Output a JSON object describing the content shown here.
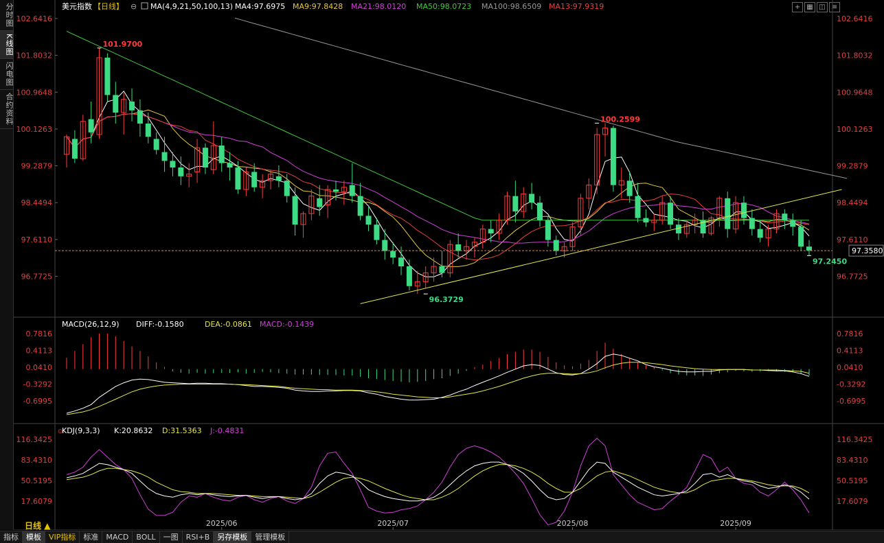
{
  "sidebar": {
    "tabs": [
      {
        "label": "分时图",
        "active": false
      },
      {
        "label": "K线图",
        "active": true
      },
      {
        "label": "闪电图",
        "active": false
      },
      {
        "label": "合约资料",
        "active": false
      }
    ]
  },
  "header": {
    "instrument": "美元指数",
    "period_tag": "【日线】",
    "ma_label": "MA(4,9,21,50,100,13)",
    "ma": [
      {
        "label": "MA4:97.6975",
        "color": "#ffffff"
      },
      {
        "label": "MA9:97.8428",
        "color": "#e6c84a"
      },
      {
        "label": "MA21:98.0120",
        "color": "#d040d8"
      },
      {
        "label": "MA50:98.0723",
        "color": "#40c840"
      },
      {
        "label": "MA100:98.6509",
        "color": "#999999"
      },
      {
        "label": "MA13:97.9319",
        "color": "#e84040"
      }
    ]
  },
  "toolbar_icons": [
    "zoom-in-icon",
    "grid-icon",
    "layout-icon",
    "list-icon"
  ],
  "bottom_bar": {
    "period": "日线",
    "buttons": [
      {
        "label": "指标",
        "selected": false,
        "vip": false
      },
      {
        "label": "模板",
        "selected": true,
        "vip": false
      },
      {
        "label": "VIP指标",
        "selected": false,
        "vip": true
      },
      {
        "label": "标准",
        "selected": false,
        "vip": false
      },
      {
        "label": "MACD",
        "selected": false,
        "vip": false
      },
      {
        "label": "BOLL",
        "selected": false,
        "vip": false
      },
      {
        "label": "一图",
        "selected": false,
        "vip": false
      },
      {
        "label": "RSI+B",
        "selected": false,
        "vip": false
      },
      {
        "label": "另存模板",
        "selected": true,
        "vip": false
      },
      {
        "label": "管理模板",
        "selected": false,
        "vip": false
      }
    ]
  },
  "chart_data": [
    {
      "type": "candlestick",
      "title": "美元指数【日线】",
      "y_ticks": [
        "102.6416",
        "101.8032",
        "100.9648",
        "100.1263",
        "99.2879",
        "98.4494",
        "97.6110",
        "96.7725"
      ],
      "ylim": [
        96.25,
        102.75
      ],
      "x_labels": [
        {
          "label": "2025/06",
          "index": 19
        },
        {
          "label": "2025/07",
          "index": 40
        },
        {
          "label": "2025/08",
          "index": 62
        },
        {
          "label": "2025/09",
          "index": 82
        }
      ],
      "current_price": "97.3580",
      "annotations": [
        {
          "label": "101.9700",
          "index": 4,
          "value": 101.97,
          "color": "#ff3b3b",
          "pos": "above"
        },
        {
          "label": "96.3729",
          "index": 44,
          "value": 96.3729,
          "color": "#3ddc84",
          "pos": "below"
        },
        {
          "label": "100.2599",
          "index": 65,
          "value": 100.2599,
          "color": "#ff3b3b",
          "pos": "above"
        },
        {
          "label": "97.2450",
          "index": 91,
          "value": 97.245,
          "color": "#3ddc84",
          "pos": "below"
        }
      ],
      "trendline": {
        "from": [
          36,
          96.15
        ],
        "to": [
          95,
          98.75
        ],
        "color": "#e6e64a"
      },
      "ohlc": [
        [
          99.55,
          100.0,
          99.25,
          99.95
        ],
        [
          99.9,
          100.1,
          99.35,
          99.45
        ],
        [
          99.45,
          100.45,
          99.4,
          100.3
        ],
        [
          100.35,
          100.75,
          99.8,
          100.05
        ],
        [
          100.0,
          101.97,
          99.9,
          101.75
        ],
        [
          101.75,
          101.85,
          100.75,
          100.9
        ],
        [
          100.9,
          101.2,
          100.25,
          100.5
        ],
        [
          100.5,
          100.95,
          100.0,
          100.8
        ],
        [
          100.75,
          101.05,
          100.3,
          100.55
        ],
        [
          100.55,
          100.8,
          99.95,
          100.25
        ],
        [
          100.25,
          100.5,
          99.8,
          99.95
        ],
        [
          99.9,
          100.05,
          99.55,
          99.65
        ],
        [
          99.6,
          99.95,
          99.15,
          99.4
        ],
        [
          99.4,
          99.6,
          99.05,
          99.25
        ],
        [
          99.25,
          99.5,
          98.85,
          99.05
        ],
        [
          99.05,
          99.35,
          98.8,
          99.1
        ],
        [
          99.15,
          99.9,
          98.9,
          99.7
        ],
        [
          99.7,
          99.8,
          99.1,
          99.25
        ],
        [
          99.2,
          100.3,
          99.1,
          99.75
        ],
        [
          99.75,
          99.95,
          99.15,
          99.35
        ],
        [
          99.35,
          99.6,
          98.95,
          99.25
        ],
        [
          99.25,
          99.4,
          98.65,
          98.75
        ],
        [
          98.75,
          99.25,
          98.6,
          99.15
        ],
        [
          99.15,
          99.35,
          98.7,
          98.8
        ],
        [
          98.8,
          99.1,
          98.55,
          98.95
        ],
        [
          98.95,
          99.2,
          98.75,
          99.1
        ],
        [
          99.05,
          99.3,
          98.8,
          98.95
        ],
        [
          98.95,
          99.1,
          98.45,
          98.6
        ],
        [
          98.6,
          98.8,
          97.7,
          97.95
        ],
        [
          97.95,
          98.25,
          97.65,
          98.2
        ],
        [
          98.2,
          98.75,
          98.05,
          98.6
        ],
        [
          98.55,
          98.85,
          98.15,
          98.35
        ],
        [
          98.4,
          98.85,
          98.1,
          98.75
        ],
        [
          98.75,
          98.95,
          98.5,
          98.7
        ],
        [
          98.7,
          98.95,
          98.4,
          98.8
        ],
        [
          98.85,
          99.35,
          98.45,
          98.6
        ],
        [
          98.6,
          98.9,
          98.05,
          98.15
        ],
        [
          98.15,
          98.35,
          97.8,
          97.95
        ],
        [
          97.95,
          98.1,
          97.5,
          97.6
        ],
        [
          97.6,
          97.85,
          97.15,
          97.35
        ],
        [
          97.35,
          97.55,
          97.05,
          97.2
        ],
        [
          97.2,
          97.45,
          96.8,
          97.0
        ],
        [
          97.0,
          97.15,
          96.45,
          96.55
        ],
        [
          96.55,
          96.9,
          96.37,
          96.65
        ],
        [
          96.65,
          97.0,
          96.5,
          96.85
        ],
        [
          96.85,
          97.2,
          96.65,
          97.0
        ],
        [
          97.0,
          97.35,
          96.75,
          96.85
        ],
        [
          96.85,
          97.6,
          96.75,
          97.5
        ],
        [
          97.5,
          97.75,
          97.2,
          97.35
        ],
        [
          97.35,
          97.6,
          97.15,
          97.45
        ],
        [
          97.45,
          97.65,
          97.2,
          97.55
        ],
        [
          97.55,
          97.95,
          97.4,
          97.85
        ],
        [
          97.85,
          98.05,
          97.55,
          97.75
        ],
        [
          97.75,
          98.2,
          97.6,
          98.05
        ],
        [
          98.05,
          98.7,
          97.95,
          98.6
        ],
        [
          98.6,
          98.95,
          98.0,
          98.25
        ],
        [
          98.25,
          98.8,
          98.1,
          98.65
        ],
        [
          98.65,
          98.9,
          98.3,
          98.45
        ],
        [
          98.45,
          98.6,
          97.9,
          98.05
        ],
        [
          98.05,
          98.15,
          97.45,
          97.6
        ],
        [
          97.6,
          97.7,
          97.25,
          97.35
        ],
        [
          97.35,
          97.55,
          97.2,
          97.45
        ],
        [
          97.45,
          98.0,
          97.35,
          97.9
        ],
        [
          97.9,
          98.65,
          97.7,
          98.55
        ],
        [
          98.55,
          99.0,
          98.3,
          98.85
        ],
        [
          98.85,
          100.15,
          98.65,
          100.0
        ],
        [
          100.0,
          100.26,
          99.5,
          100.15
        ],
        [
          100.15,
          100.2,
          98.7,
          98.85
        ],
        [
          98.85,
          99.25,
          98.55,
          98.95
        ],
        [
          98.95,
          99.15,
          98.45,
          98.6
        ],
        [
          98.6,
          98.9,
          98.0,
          98.1
        ],
        [
          98.1,
          98.3,
          97.9,
          98.0
        ],
        [
          98.0,
          98.2,
          97.8,
          98.05
        ],
        [
          98.05,
          98.6,
          97.95,
          98.45
        ],
        [
          98.45,
          98.6,
          97.85,
          97.95
        ],
        [
          97.95,
          98.1,
          97.6,
          97.75
        ],
        [
          97.75,
          98.05,
          97.65,
          97.95
        ],
        [
          97.95,
          98.2,
          97.75,
          98.05
        ],
        [
          98.05,
          98.25,
          97.65,
          97.75
        ],
        [
          97.75,
          98.15,
          97.7,
          98.1
        ],
        [
          98.1,
          98.6,
          97.9,
          98.55
        ],
        [
          98.55,
          98.7,
          97.65,
          97.85
        ],
        [
          97.85,
          98.6,
          97.75,
          98.45
        ],
        [
          98.45,
          98.6,
          97.95,
          98.1
        ],
        [
          98.1,
          98.3,
          97.7,
          97.85
        ],
        [
          97.85,
          98.05,
          97.55,
          97.65
        ],
        [
          97.65,
          97.95,
          97.45,
          97.85
        ],
        [
          97.85,
          98.3,
          97.75,
          98.2
        ],
        [
          98.2,
          98.3,
          97.85,
          98.05
        ],
        [
          98.05,
          98.2,
          97.7,
          97.9
        ],
        [
          97.9,
          98.05,
          97.35,
          97.45
        ],
        [
          97.45,
          97.6,
          97.245,
          97.36
        ]
      ]
    },
    {
      "type": "macd",
      "title": "MACD(26,12,9)",
      "values": [
        {
          "label": "DIFF:-0.1580",
          "color": "#ffffff"
        },
        {
          "label": "DEA:-0.0861",
          "color": "#e6e64a"
        },
        {
          "label": "MACD:-0.1439",
          "color": "#d040d8"
        }
      ],
      "y_ticks": [
        "0.7816",
        "0.4113",
        "0.0410",
        "-0.3292",
        "-0.6995"
      ],
      "ylim": [
        -1.0,
        0.9
      ],
      "hist": [
        0.25,
        0.4,
        0.55,
        0.7,
        0.78,
        0.78,
        0.72,
        0.62,
        0.5,
        0.4,
        0.28,
        0.15,
        0.05,
        -0.05,
        -0.08,
        -0.1,
        -0.08,
        -0.1,
        -0.09,
        -0.08,
        -0.08,
        -0.07,
        -0.1,
        -0.08,
        -0.06,
        -0.07,
        -0.09,
        -0.1,
        -0.12,
        -0.12,
        -0.12,
        -0.13,
        -0.13,
        -0.13,
        -0.14,
        -0.14,
        -0.17,
        -0.2,
        -0.22,
        -0.24,
        -0.26,
        -0.28,
        -0.29,
        -0.28,
        -0.26,
        -0.22,
        -0.2,
        -0.15,
        -0.1,
        -0.04,
        0.04,
        0.1,
        0.18,
        0.24,
        0.33,
        0.38,
        0.43,
        0.43,
        0.38,
        0.27,
        0.15,
        0.08,
        0.06,
        0.12,
        0.2,
        0.4,
        0.58,
        0.45,
        0.33,
        0.24,
        0.14,
        0.08,
        0.04,
        -0.03,
        -0.09,
        -0.12,
        -0.14,
        -0.14,
        -0.15,
        -0.12,
        -0.09,
        -0.07,
        -0.04,
        -0.05,
        -0.06,
        -0.05,
        -0.04,
        -0.05,
        -0.06,
        -0.07,
        -0.1,
        -0.14
      ],
      "diff": [
        -0.97,
        -0.92,
        -0.86,
        -0.78,
        -0.62,
        -0.5,
        -0.38,
        -0.3,
        -0.24,
        -0.22,
        -0.23,
        -0.26,
        -0.29,
        -0.3,
        -0.31,
        -0.32,
        -0.31,
        -0.31,
        -0.32,
        -0.32,
        -0.33,
        -0.34,
        -0.36,
        -0.38,
        -0.38,
        -0.39,
        -0.4,
        -0.42,
        -0.46,
        -0.48,
        -0.49,
        -0.49,
        -0.48,
        -0.48,
        -0.47,
        -0.47,
        -0.48,
        -0.52,
        -0.55,
        -0.6,
        -0.63,
        -0.66,
        -0.68,
        -0.68,
        -0.67,
        -0.66,
        -0.62,
        -0.57,
        -0.5,
        -0.44,
        -0.36,
        -0.29,
        -0.22,
        -0.15,
        -0.07,
        0.0,
        0.07,
        0.1,
        0.08,
        0.0,
        -0.08,
        -0.12,
        -0.13,
        -0.1,
        0.0,
        0.12,
        0.28,
        0.33,
        0.3,
        0.24,
        0.18,
        0.1,
        0.05,
        0.02,
        -0.02,
        -0.05,
        -0.06,
        -0.06,
        -0.05,
        -0.05,
        -0.02,
        -0.01,
        -0.01,
        -0.01,
        -0.02,
        -0.02,
        -0.03,
        -0.04,
        -0.04,
        -0.06,
        -0.1,
        -0.16
      ],
      "dea": [
        -1.0,
        -0.97,
        -0.94,
        -0.89,
        -0.82,
        -0.74,
        -0.66,
        -0.58,
        -0.5,
        -0.44,
        -0.4,
        -0.37,
        -0.35,
        -0.34,
        -0.33,
        -0.33,
        -0.33,
        -0.33,
        -0.33,
        -0.33,
        -0.33,
        -0.34,
        -0.34,
        -0.35,
        -0.36,
        -0.37,
        -0.38,
        -0.4,
        -0.42,
        -0.43,
        -0.44,
        -0.45,
        -0.45,
        -0.46,
        -0.46,
        -0.46,
        -0.47,
        -0.48,
        -0.5,
        -0.52,
        -0.55,
        -0.57,
        -0.59,
        -0.61,
        -0.62,
        -0.63,
        -0.63,
        -0.61,
        -0.58,
        -0.55,
        -0.52,
        -0.48,
        -0.43,
        -0.38,
        -0.32,
        -0.26,
        -0.2,
        -0.15,
        -0.11,
        -0.09,
        -0.09,
        -0.1,
        -0.11,
        -0.1,
        -0.08,
        -0.04,
        0.03,
        0.09,
        0.13,
        0.15,
        0.15,
        0.14,
        0.12,
        0.1,
        0.07,
        0.05,
        0.03,
        0.01,
        0.0,
        -0.01,
        -0.01,
        -0.01,
        -0.01,
        -0.01,
        -0.02,
        -0.02,
        -0.02,
        -0.02,
        -0.03,
        -0.04,
        -0.05,
        -0.09
      ]
    },
    {
      "type": "kdj",
      "title": "KDJ(9,3,3)",
      "values": [
        {
          "label": "K:20.8632",
          "color": "#ffffff"
        },
        {
          "label": "D:31.5363",
          "color": "#e6e64a"
        },
        {
          "label": "J:-0.4831",
          "color": "#d040d8"
        }
      ],
      "y_ticks": [
        "116.3425",
        "83.4310",
        "50.5195",
        "17.6079"
      ],
      "ylim": [
        -15,
        125
      ],
      "k": [
        55,
        58,
        62,
        70,
        78,
        76,
        72,
        68,
        62,
        50,
        38,
        30,
        26,
        24,
        28,
        30,
        28,
        30,
        28,
        26,
        25,
        26,
        27,
        24,
        22,
        24,
        25,
        22,
        20,
        22,
        30,
        46,
        58,
        64,
        62,
        58,
        48,
        36,
        30,
        25,
        22,
        20,
        18,
        18,
        20,
        24,
        32,
        44,
        56,
        66,
        74,
        78,
        80,
        80,
        76,
        70,
        62,
        50,
        36,
        24,
        20,
        22,
        32,
        50,
        68,
        80,
        78,
        64,
        56,
        48,
        40,
        34,
        28,
        26,
        28,
        30,
        34,
        46,
        60,
        62,
        56,
        60,
        54,
        50,
        48,
        42,
        38,
        40,
        44,
        40,
        32,
        21
      ],
      "d": [
        52,
        54,
        56,
        60,
        66,
        70,
        70,
        68,
        66,
        62,
        56,
        48,
        42,
        36,
        33,
        32,
        30,
        30,
        30,
        29,
        28,
        27,
        27,
        26,
        25,
        25,
        25,
        24,
        23,
        22,
        25,
        32,
        40,
        48,
        54,
        56,
        54,
        50,
        44,
        38,
        33,
        28,
        24,
        22,
        20,
        20,
        24,
        30,
        38,
        48,
        58,
        66,
        72,
        76,
        76,
        74,
        70,
        64,
        56,
        46,
        38,
        32,
        32,
        38,
        48,
        58,
        64,
        66,
        62,
        58,
        52,
        46,
        40,
        36,
        33,
        31,
        31,
        36,
        44,
        50,
        52,
        54,
        54,
        52,
        50,
        47,
        44,
        42,
        42,
        42,
        38,
        31
      ],
      "j": [
        60,
        64,
        72,
        88,
        100,
        88,
        76,
        68,
        54,
        28,
        5,
        -5,
        -5,
        0,
        16,
        26,
        24,
        30,
        24,
        20,
        18,
        24,
        27,
        20,
        16,
        22,
        25,
        18,
        14,
        22,
        40,
        74,
        94,
        96,
        78,
        62,
        36,
        8,
        2,
        -1,
        0,
        4,
        6,
        10,
        20,
        32,
        48,
        72,
        92,
        102,
        106,
        102,
        96,
        88,
        76,
        62,
        46,
        22,
        -4,
        -20,
        -16,
        2,
        32,
        74,
        106,
        118,
        106,
        60,
        44,
        28,
        16,
        10,
        4,
        6,
        18,
        28,
        40,
        66,
        92,
        86,
        64,
        72,
        54,
        46,
        44,
        32,
        26,
        36,
        48,
        36,
        20,
        -1
      ]
    }
  ]
}
